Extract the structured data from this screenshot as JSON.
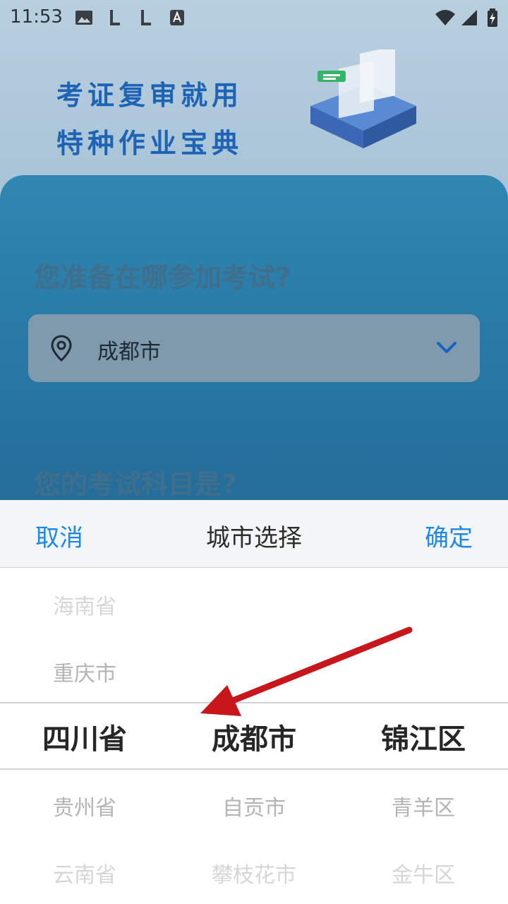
{
  "status_bar": {
    "time": "11:53",
    "icons": [
      "image-icon",
      "l-app-icon",
      "l-app-icon",
      "a-app-icon",
      "wifi-icon",
      "signal-icon",
      "battery-charging-icon"
    ]
  },
  "hero": {
    "slogan_line1": "考证复审就用",
    "slogan_line2": "特种作业宝典"
  },
  "form": {
    "location_question": "您准备在哪参加考试?",
    "selected_city": "成都市",
    "subject_question": "您的考试科目是?"
  },
  "picker": {
    "cancel_label": "取消",
    "title": "城市选择",
    "confirm_label": "确定",
    "provinces": {
      "above2": "海南省",
      "above1": "重庆市",
      "selected": "四川省",
      "below1": "贵州省",
      "below2": "云南省"
    },
    "cities": {
      "selected": "成都市",
      "below1": "自贡市",
      "below2": "攀枝花市"
    },
    "districts": {
      "selected": "锦江区",
      "below1": "青羊区",
      "below2": "金牛区"
    }
  },
  "colors": {
    "accent": "#1e88e5",
    "annotation_arrow": "#c8161d",
    "slogan": "#1f63b5"
  }
}
